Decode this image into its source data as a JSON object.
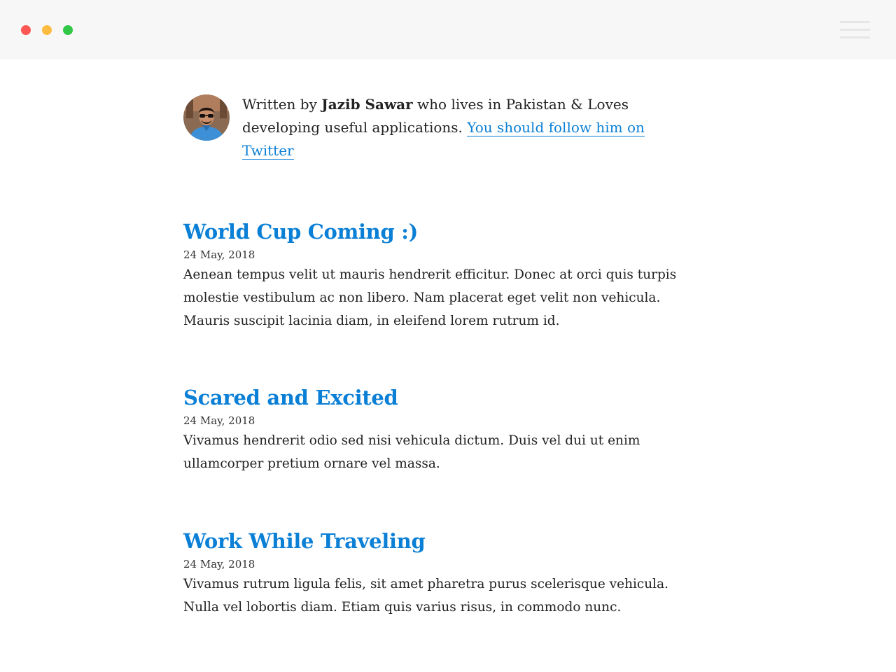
{
  "window": {
    "controls": [
      "close",
      "minimize",
      "maximize"
    ],
    "menu_icon": "hamburger-menu-icon"
  },
  "author": {
    "prefix": "Written by ",
    "name": "Jazib Sawar",
    "middle": " who lives in Pakistan & Loves developing useful applications. ",
    "twitter_link": "You should follow him on Twitter",
    "avatar_icon": "avatar-photo"
  },
  "posts": [
    {
      "title": "World Cup Coming :)",
      "date": "24 May, 2018",
      "excerpt": "Aenean tempus velit ut mauris hendrerit efficitur. Donec at orci quis turpis molestie vestibulum ac non libero. Nam placerat eget velit non vehicula. Mauris suscipit lacinia diam, in eleifend lorem rutrum id."
    },
    {
      "title": "Scared and Excited",
      "date": "24 May, 2018",
      "excerpt": "Vivamus hendrerit odio sed nisi vehicula dictum. Duis vel dui ut enim ullamcorper pretium ornare vel massa."
    },
    {
      "title": "Work While Traveling",
      "date": "24 May, 2018",
      "excerpt": "Vivamus rutrum ligula felis, sit amet pharetra purus scelerisque vehicula. Nulla vel lobortis diam. Etiam quis varius risus, in commodo nunc."
    }
  ],
  "colors": {
    "accent": "#0a7fd6",
    "window_bar": "#f7f7f7",
    "close": "#fc5753",
    "minimize": "#fdbc40",
    "maximize": "#33c748"
  }
}
